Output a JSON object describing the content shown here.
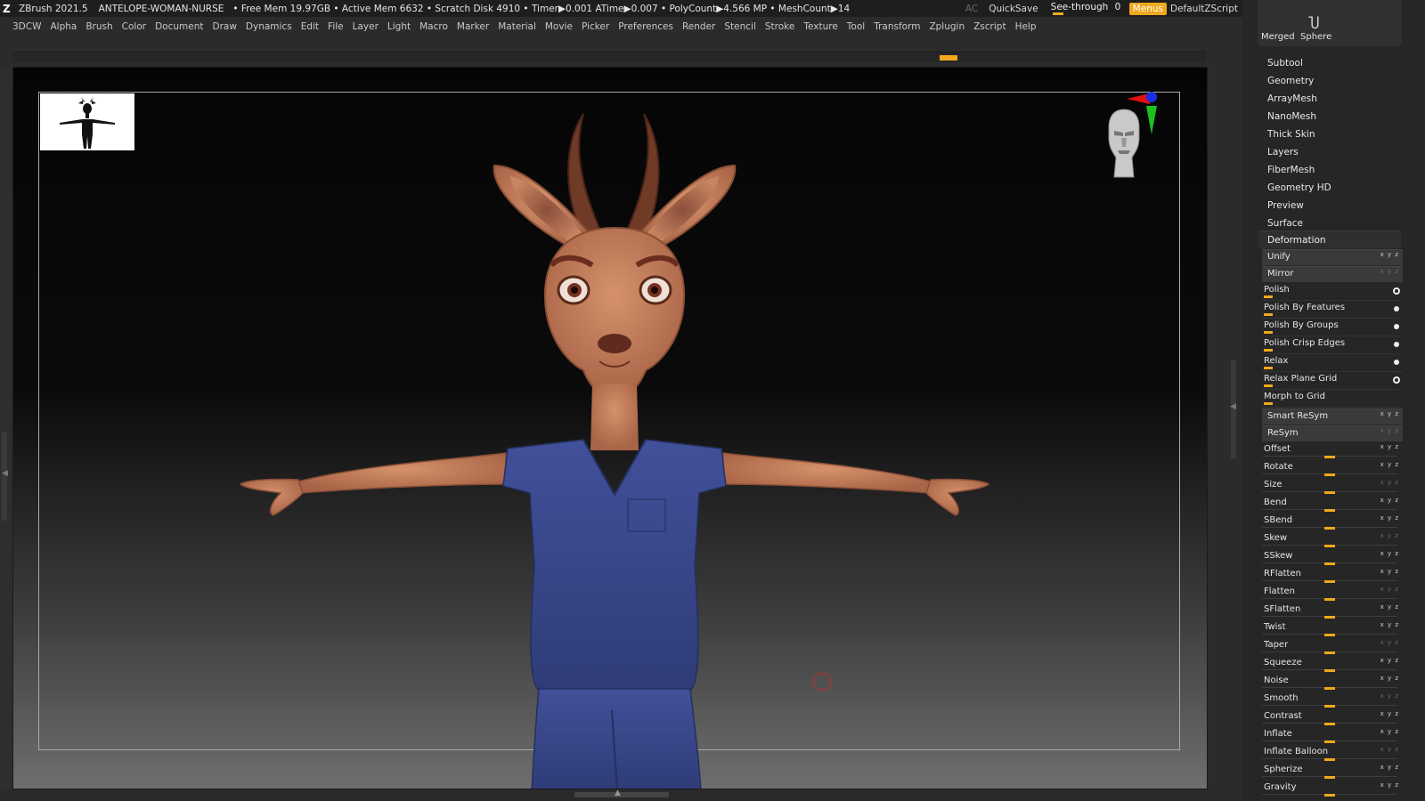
{
  "titlebar": {
    "app": "ZBrush 2021.5",
    "project": "ANTELOPE-WOMAN-NURSE",
    "stats": "• Free Mem 19.97GB • Active Mem 6632 • Scratch Disk 4910 •  Timer▶0.001 ATime▶0.007 • PolyCount▶4.566 MP  • MeshCount▶14",
    "ac": "AC",
    "quicksave": "QuickSave",
    "seethrough_label": "See-through",
    "seethrough_value": "0",
    "menus": "Menus",
    "script": "DefaultZScript"
  },
  "menu": [
    "3DCW",
    "Alpha",
    "Brush",
    "Color",
    "Document",
    "Draw",
    "Dynamics",
    "Edit",
    "File",
    "Layer",
    "Light",
    "Macro",
    "Marker",
    "Material",
    "Movie",
    "Picker",
    "Preferences",
    "Render",
    "Stencil",
    "Stroke",
    "Texture",
    "Tool",
    "Transform",
    "Zplugin",
    "Zscript",
    "Help"
  ],
  "tray": {
    "thumb_left": "Merged",
    "thumb_right": "Sphere",
    "subpanels": [
      "Subtool",
      "Geometry",
      "ArrayMesh",
      "NanoMesh",
      "Thick Skin",
      "Layers",
      "FiberMesh",
      "Geometry HD",
      "Preview",
      "Surface"
    ],
    "deformation_title": "Deformation",
    "rows": [
      {
        "label": "Unify",
        "kind": "btn",
        "xyz": "xyz"
      },
      {
        "label": "Mirror",
        "kind": "btn",
        "xyz": "xyz"
      },
      {
        "label": "Polish",
        "kind": "tog",
        "dot": "ring"
      },
      {
        "label": "Polish By Features",
        "kind": "tog",
        "dot": "solid"
      },
      {
        "label": "Polish By Groups",
        "kind": "tog",
        "dot": "solid"
      },
      {
        "label": "Polish Crisp Edges",
        "kind": "tog",
        "dot": "solid"
      },
      {
        "label": "Relax",
        "kind": "tog",
        "dot": "solid"
      },
      {
        "label": "Relax Plane Grid",
        "kind": "tog",
        "dot": "ring"
      },
      {
        "label": "Morph to Grid",
        "kind": "tog",
        "dot": "none"
      },
      {
        "label": "Smart ReSym",
        "kind": "btn",
        "xyz": "xyz"
      },
      {
        "label": "ReSym",
        "kind": "btn",
        "xyz": "xyz"
      },
      {
        "label": "Offset",
        "kind": "slide",
        "xyz": "xyz"
      },
      {
        "label": "Rotate",
        "kind": "slide",
        "xyz": "xyz"
      },
      {
        "label": "Size",
        "kind": "slide",
        "xyz": "xyz"
      },
      {
        "label": "Bend",
        "kind": "slide",
        "xyz": "xyz"
      },
      {
        "label": "SBend",
        "kind": "slide",
        "xyz": "xyz"
      },
      {
        "label": "Skew",
        "kind": "slide",
        "xyz": "xyz"
      },
      {
        "label": "SSkew",
        "kind": "slide",
        "xyz": "xyz"
      },
      {
        "label": "RFlatten",
        "kind": "slide",
        "xyz": "xyz"
      },
      {
        "label": "Flatten",
        "kind": "slide",
        "xyz": "xyz"
      },
      {
        "label": "SFlatten",
        "kind": "slide",
        "xyz": "xyz"
      },
      {
        "label": "Twist",
        "kind": "slide",
        "xyz": "xyz"
      },
      {
        "label": "Taper",
        "kind": "slide",
        "xyz": "xyz"
      },
      {
        "label": "Squeeze",
        "kind": "slide",
        "xyz": "xyz"
      },
      {
        "label": "Noise",
        "kind": "slide",
        "xyz": "xyz"
      },
      {
        "label": "Smooth",
        "kind": "slide",
        "xyz": "xyz"
      },
      {
        "label": "Contrast",
        "kind": "slide",
        "xyz": "xyz"
      },
      {
        "label": "Inflate",
        "kind": "slide",
        "xyz": "xyz"
      },
      {
        "label": "Inflate Balloon",
        "kind": "slide",
        "xyz": "xyz"
      },
      {
        "label": "Spherize",
        "kind": "slide",
        "xyz": "xyz"
      },
      {
        "label": "Gravity",
        "kind": "slide",
        "xyz": "xyz"
      }
    ]
  },
  "colors": {
    "accent": "#f0a81c",
    "skin": "#c98562",
    "scrubs": "#3b4a8c",
    "cursor": "#c8282a"
  },
  "icons": [
    "zbrush-logo-icon",
    "magnet-icon",
    "head-gizmo-icon",
    "axis-gizmo-icon",
    "silhouette-icon"
  ]
}
